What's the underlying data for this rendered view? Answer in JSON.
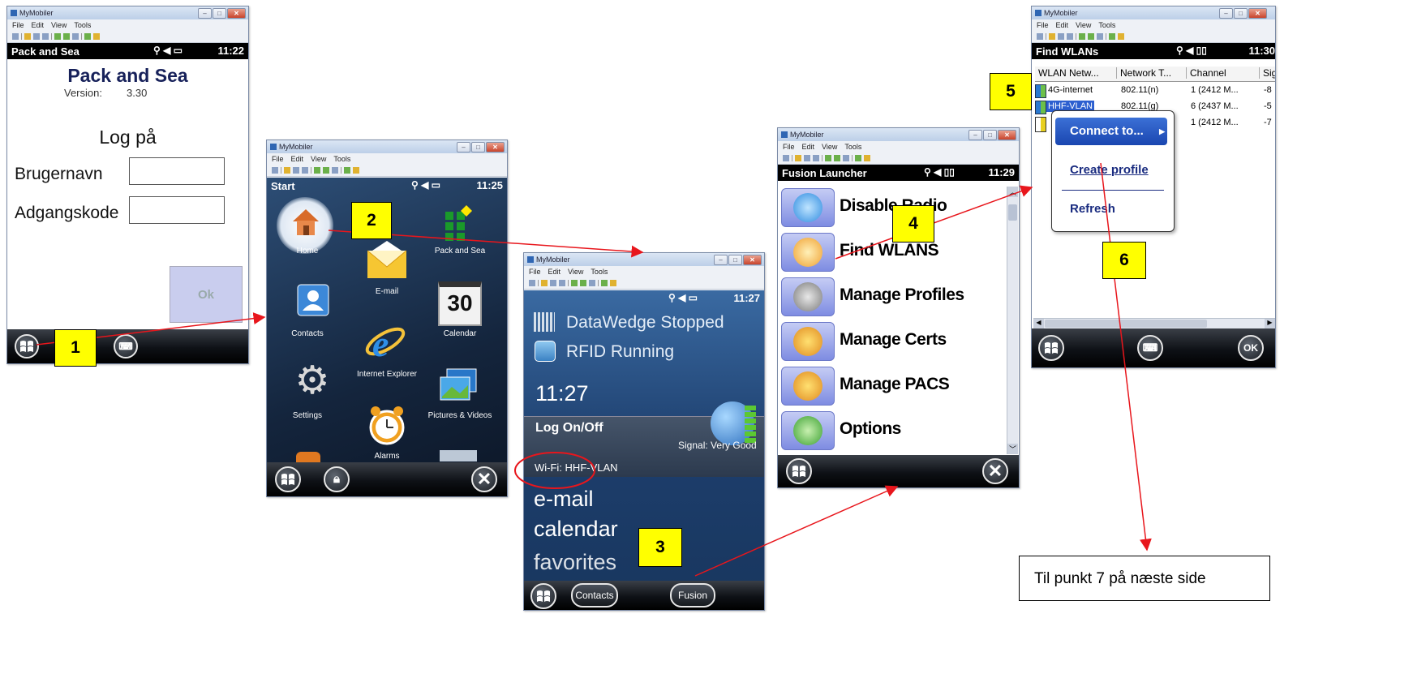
{
  "win_chrome": {
    "title": "MyMobiler",
    "menu": [
      "File",
      "Edit",
      "View",
      "Tools"
    ]
  },
  "screen1": {
    "status_title": "Pack and Sea",
    "time": "11:22",
    "app_title": "Pack and Sea",
    "version_label": "Version:",
    "version": "3.30",
    "login_title": "Log på",
    "username_label": "Brugernavn",
    "password_label": "Adgangskode",
    "ok_label": "Ok"
  },
  "screen2": {
    "status_title": "Start",
    "time": "11:25",
    "tiles": [
      {
        "label": "Home",
        "icon": "home-icon"
      },
      {
        "label": "Pack and Sea",
        "icon": "pack-and-sea-icon"
      },
      {
        "label": "E-mail",
        "icon": "email-icon"
      },
      {
        "label": "Contacts",
        "icon": "contacts-icon"
      },
      {
        "label": "30",
        "icon": "calendar-icon"
      },
      {
        "label": "Calendar",
        "icon": "calendar-icon"
      },
      {
        "label": "Internet Explorer",
        "icon": "internet-explorer-icon"
      },
      {
        "label": "Settings",
        "icon": "settings-icon"
      },
      {
        "label": "Pictures & Videos",
        "icon": "pictures-icon"
      },
      {
        "label": "Alarms",
        "icon": "alarm-icon"
      }
    ]
  },
  "screen3": {
    "time": "11:27",
    "datawedge": "DataWedge Stopped",
    "rfid": "RFID Running",
    "clock": "11:27",
    "logon": "Log On/Off",
    "signal": "Signal: Very Good",
    "wifi": "Wi-Fi: HHF-VLAN",
    "email": "e-mail",
    "calendar": "calendar",
    "favorites": "favorites",
    "contacts_btn": "Contacts",
    "fusion_btn": "Fusion"
  },
  "screen4": {
    "status_title": "Fusion Launcher",
    "time": "11:29",
    "items": [
      "Disable Radio",
      "Find WLANS",
      "Manage Profiles",
      "Manage Certs",
      "Manage PACS",
      "Options"
    ]
  },
  "screen5": {
    "status_title": "Find WLANs",
    "time": "11:30",
    "columns": [
      "WLAN Netw...",
      "Network T...",
      "Channel",
      "Sig"
    ],
    "rows": [
      [
        "4G-internet",
        "802.11(n)",
        "1 (2412 M...",
        "-8"
      ],
      [
        "HHF-VLAN",
        "802.11(g)",
        "6 (2437 M...",
        "-5"
      ],
      [
        "",
        "",
        "1 (2412 M...",
        "-7"
      ]
    ],
    "context_menu": [
      "Connect to...",
      "Create profile",
      "Refresh"
    ],
    "ok_label": "OK"
  },
  "steps": [
    "1",
    "2",
    "3",
    "4",
    "5",
    "6"
  ],
  "note": "Til punkt 7 på næste side",
  "colors": {
    "arrow": "#e8161c",
    "step_bg": "#ffff00"
  }
}
